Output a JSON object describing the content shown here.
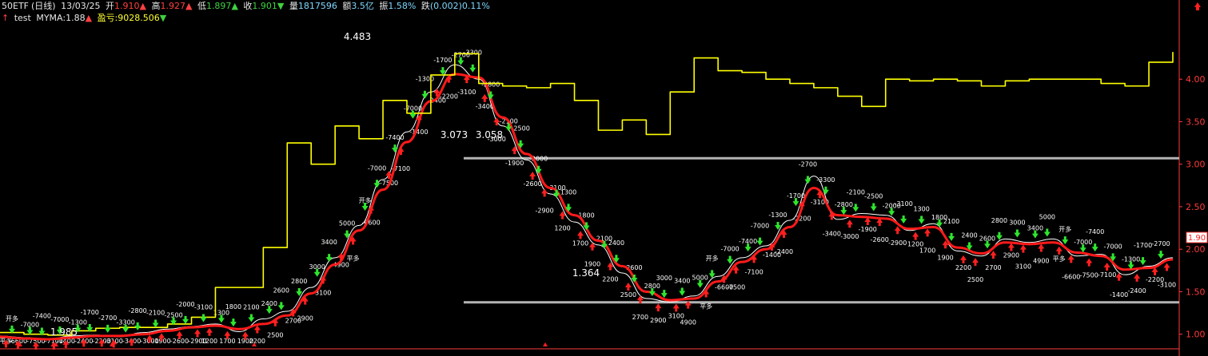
{
  "header": {
    "symbol": "50ETF",
    "period": "(日线)",
    "date": "13/03/25",
    "open_label": "开",
    "open": "1.910",
    "high_label": "高",
    "high": "1.927",
    "low_label": "低",
    "low": "1.897",
    "close_label": "收",
    "close": "1.901",
    "volume_label": "量",
    "volume": "1817596",
    "amount_label": "额",
    "amount": "3.5亿",
    "amplitude_label": "振",
    "amplitude": "1.58%",
    "change_label": "跌",
    "change": "(0.002)0.11%"
  },
  "indicator": {
    "name": "test",
    "myma_label": "MYMA:",
    "myma": "1.88",
    "pnl_label": "盈亏:",
    "pnl": "9028.506"
  },
  "price_tag": "1.90",
  "colors": {
    "background": "#000000",
    "axis": "#ff3b3b",
    "equity_line": "#ffff00",
    "ma_line": "#ff1a1a",
    "price_line": "#ffffff",
    "level_line": "#b4b4b4",
    "buy_arrow": "#ff2020",
    "sell_arrow": "#2ee62e"
  },
  "chart_data": {
    "type": "line",
    "yaxis": {
      "ticks": [
        "4.00",
        "3.50",
        "3.00",
        "2.50",
        "2.00",
        "1.50",
        "1.00"
      ],
      "ylim": [
        0.8,
        4.65
      ]
    },
    "grid": false,
    "horizontal_levels": [
      3.07,
      1.375
    ],
    "annotations": [
      {
        "text": "4.483",
        "value": 4.483
      },
      {
        "text": "3.073",
        "value": 3.073
      },
      {
        "text": "3.058",
        "value": 3.058
      },
      {
        "text": "1.364",
        "value": 1.364
      },
      {
        "text": "1.985",
        "value": 0.985
      }
    ],
    "x_index": [
      0,
      30,
      60,
      90,
      120,
      150,
      180,
      210,
      240,
      270,
      300,
      330,
      360,
      390,
      420,
      450,
      480,
      510,
      540,
      570,
      600,
      630,
      660,
      690,
      720,
      750,
      780,
      810,
      840,
      870,
      900,
      930,
      960,
      990,
      1020,
      1050,
      1080,
      1110,
      1140,
      1170,
      1200,
      1230,
      1260,
      1290,
      1320,
      1350,
      1380,
      1410,
      1440,
      1470
    ],
    "series": [
      {
        "values": [
          0.98,
          0.96,
          0.94,
          0.98,
          0.99,
          0.97,
          1.02,
          1.06,
          1.09,
          1.12,
          1.03,
          1.18,
          1.27,
          1.55,
          1.9,
          2.28,
          2.82,
          3.38,
          3.85,
          4.17,
          4.0,
          3.45,
          3.05,
          2.65,
          2.32,
          2.05,
          1.72,
          1.42,
          1.38,
          1.45,
          1.68,
          1.9,
          2.04,
          2.34,
          2.86,
          2.35,
          2.42,
          2.4,
          2.22,
          2.3,
          1.98,
          1.92,
          2.12,
          2.08,
          2.12,
          1.92,
          1.94,
          1.7,
          1.8,
          1.9
        ]
      },
      {
        "values": [
          0.97,
          0.95,
          0.94,
          0.96,
          0.98,
          0.98,
          1.0,
          1.04,
          1.08,
          1.1,
          1.06,
          1.12,
          1.22,
          1.48,
          1.82,
          2.22,
          2.7,
          3.26,
          3.74,
          4.06,
          4.02,
          3.55,
          3.12,
          2.72,
          2.4,
          2.1,
          1.8,
          1.5,
          1.4,
          1.42,
          1.62,
          1.85,
          2.0,
          2.26,
          2.72,
          2.4,
          2.38,
          2.36,
          2.24,
          2.26,
          2.02,
          1.95,
          2.08,
          2.06,
          2.08,
          1.96,
          1.92,
          1.76,
          1.78,
          1.88
        ]
      },
      {
        "values": [
          1.02,
          1.0,
          0.99,
          1.04,
          1.07,
          1.08,
          1.08,
          1.12,
          1.2,
          1.55,
          1.55,
          2.02,
          3.25,
          3.0,
          3.45,
          3.3,
          3.75,
          3.6,
          4.05,
          4.3,
          3.95,
          3.92,
          3.9,
          3.95,
          3.75,
          3.4,
          3.52,
          3.35,
          3.85,
          4.25,
          4.1,
          4.08,
          4.0,
          3.95,
          3.9,
          3.8,
          3.68,
          4.0,
          3.98,
          4.0,
          3.98,
          3.92,
          3.98,
          4.0,
          4.0,
          4.0,
          3.95,
          3.92,
          4.2,
          4.32
        ]
      }
    ],
    "trade_labels": [
      "平多",
      "开多",
      "-6600",
      "-7000",
      "-7500",
      "-7400",
      "-7100",
      "-7000",
      "-1400",
      "-1300",
      "-2400",
      "-1700",
      "-2200",
      "-2700",
      "-3100",
      "-3300",
      "-3400",
      "-2800",
      "-3000",
      "-2100",
      "-1900",
      "-2500",
      "-2600",
      "-2000",
      "-2900",
      "-3100",
      "1200",
      "1300",
      "1700",
      "1800",
      "1900",
      "2100",
      "2200",
      "2400",
      "2500",
      "2600",
      "2700",
      "2800",
      "2900",
      "3000",
      "3100",
      "3400",
      "4900",
      "5000"
    ]
  }
}
